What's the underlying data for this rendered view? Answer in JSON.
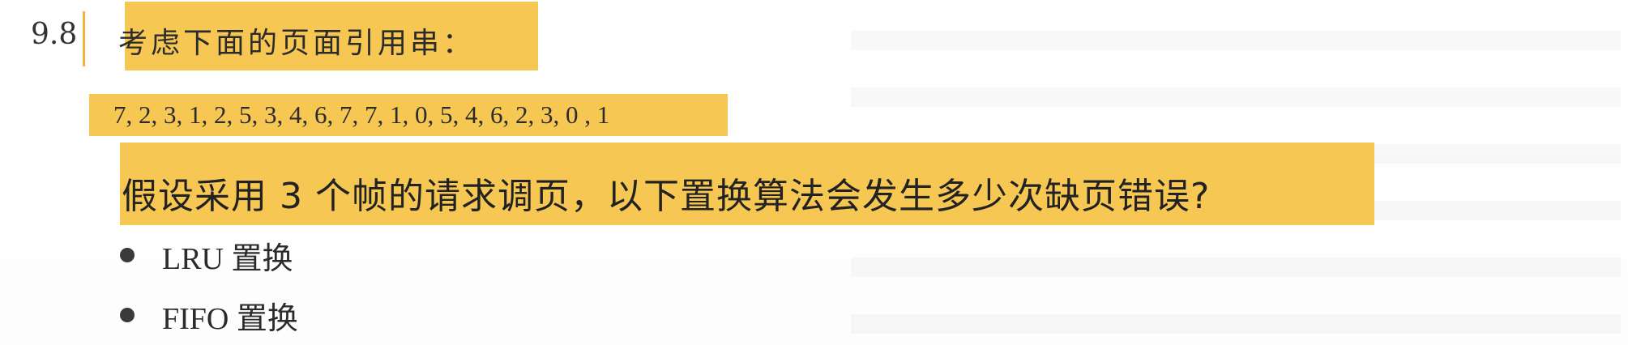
{
  "problem": {
    "number": "9.8",
    "title": "考虑下面的页面引用串：",
    "reference_string": "7, 2, 3, 1, 2, 5, 3, 4, 6, 7, 7, 1, 0, 5, 4, 6, 2, 3, 0 , 1",
    "question": "假设采用 3 个帧的请求调页，以下置换算法会发生多少次缺页错误?",
    "options": [
      {
        "label": "LRU 置换"
      },
      {
        "label": "FIFO 置换"
      }
    ]
  },
  "colors": {
    "highlight": "#f7c753",
    "rule": "#f4b23c",
    "text": "#2b2b2b"
  }
}
